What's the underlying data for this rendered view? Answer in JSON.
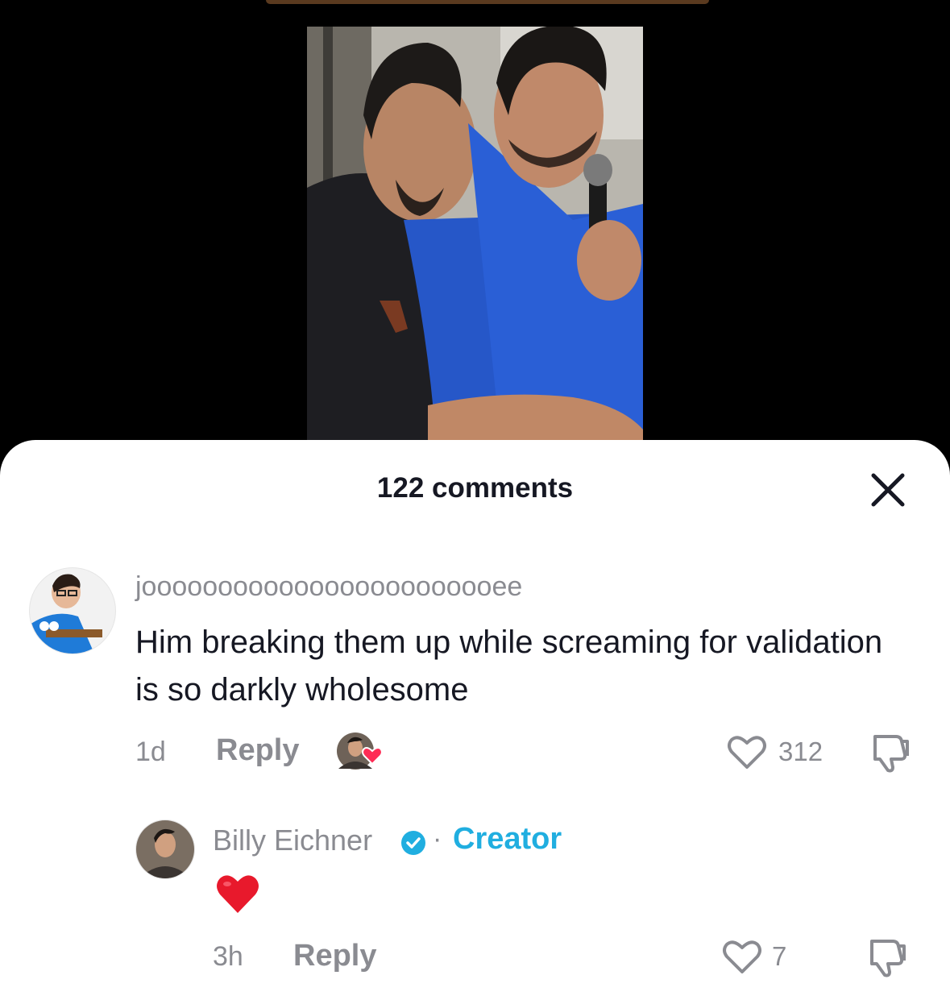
{
  "sheet": {
    "title": "122 comments"
  },
  "comments": [
    {
      "username": "joooooooooooooooooooooooee",
      "text": "Him breaking them up while screaming for validation is so darkly wholesome",
      "time": "1d",
      "reply_label": "Reply",
      "likes": "312"
    }
  ],
  "replies": [
    {
      "username": "Billy Eichner",
      "separator": "·",
      "badge": "Creator",
      "text": "❤️",
      "time": "3h",
      "reply_label": "Reply",
      "likes": "7"
    }
  ],
  "colors": {
    "accent": "#20aee0",
    "heart": "#fe2c55",
    "muted": "#8a8b91"
  }
}
